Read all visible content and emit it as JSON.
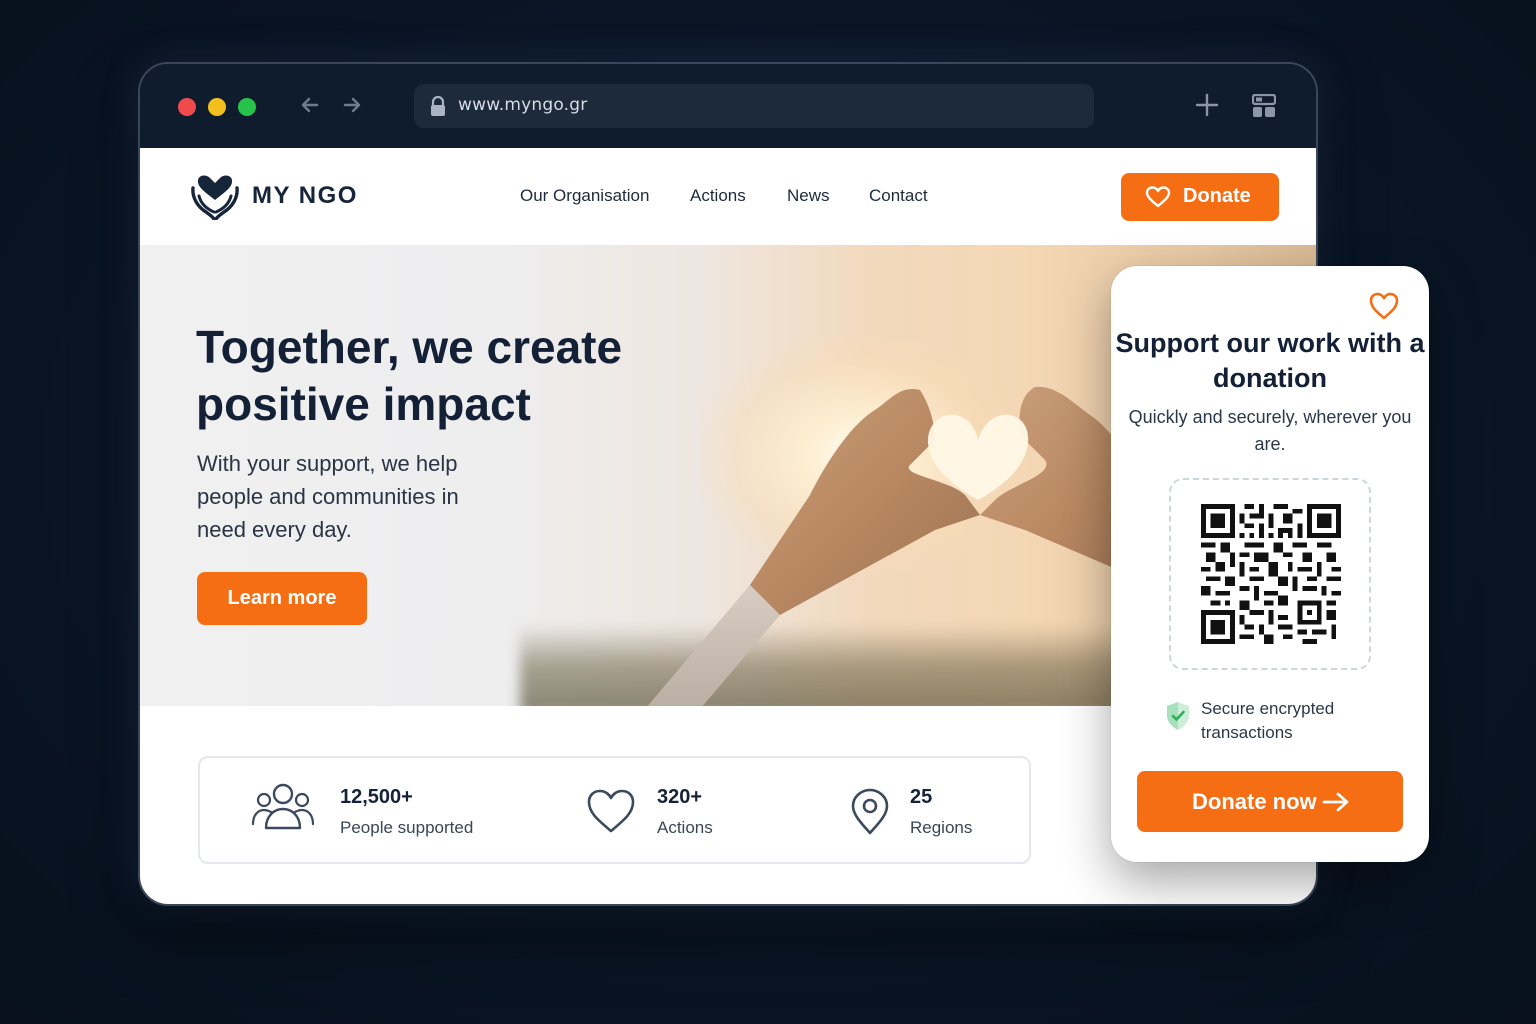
{
  "browser": {
    "url": "www.myngo.gr",
    "icons": [
      "back-arrow-icon",
      "forward-arrow-icon",
      "lock-icon",
      "plus-icon",
      "tabs-grid-icon"
    ]
  },
  "site": {
    "logo_text": "MY NGO",
    "nav": [
      "Our Organisation",
      "Actions",
      "News",
      "Contact"
    ],
    "donate_label": "Donate"
  },
  "hero": {
    "title": "Together, we create positive impact",
    "subtitle": "With your support, we help people and communities in need every day.",
    "cta_label": "Learn more"
  },
  "stats": [
    {
      "icon": "people-icon",
      "value": "12,500+",
      "label": "People supported"
    },
    {
      "icon": "heart-icon",
      "value": "320+",
      "label": "Actions"
    },
    {
      "icon": "location-pin-icon",
      "value": "25",
      "label": "Regions"
    }
  ],
  "donation_card": {
    "title": "Support our work with a donation",
    "subtitle": "Quickly and securely, wherever you are.",
    "secure_text": "Secure encrypted transactions",
    "cta_label": "Donate now"
  },
  "colors": {
    "accent": "#f56e14",
    "navy": "#132035",
    "background": "#0a1626",
    "secure_green": "#2fae5a"
  }
}
